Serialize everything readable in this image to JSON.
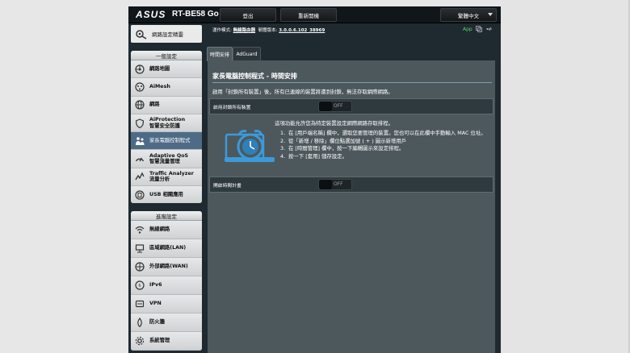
{
  "header": {
    "logo": "ASUS",
    "model": "RT-BE58 Go",
    "logout": "登出",
    "reboot": "重新開機",
    "language": "繁體中文"
  },
  "status": {
    "mode_label": "運作模式:",
    "mode_value": "無線路由器",
    "firmware_label": "韌體版本:",
    "firmware_value": "3.0.0.6.102_38969",
    "app_label": "App"
  },
  "sidebar": {
    "top_item": "網路設定精靈",
    "general_heading": "一般設定",
    "general_items": [
      {
        "label": "網路地圖",
        "icon": "network-map-icon"
      },
      {
        "label": "AiMesh",
        "icon": "aimesh-icon"
      },
      {
        "label": "網路",
        "icon": "globe-icon"
      },
      {
        "label": "AiProtection",
        "label2": "智慧安全防護",
        "icon": "shield-icon"
      },
      {
        "label": "家長電腦控制程式",
        "icon": "family-icon"
      },
      {
        "label": "Adaptive QoS",
        "label2": "智慧流量管理",
        "icon": "qos-icon"
      },
      {
        "label": "Traffic Analyzer",
        "label2": "流量分析",
        "icon": "analyzer-icon"
      },
      {
        "label": "USB 相關應用",
        "icon": "usb-icon"
      }
    ],
    "advanced_heading": "進階設定",
    "advanced_items": [
      {
        "label": "無線網路",
        "icon": "wireless-icon"
      },
      {
        "label": "區域網路(LAN)",
        "icon": "lan-icon"
      },
      {
        "label": "外部網路(WAN)",
        "icon": "wan-icon"
      },
      {
        "label": "IPv6",
        "icon": "ipv6-icon"
      },
      {
        "label": "VPN",
        "icon": "vpn-icon"
      },
      {
        "label": "防火牆",
        "icon": "firewall-icon"
      },
      {
        "label": "系統管理",
        "icon": "admin-icon"
      }
    ]
  },
  "tabs": {
    "time_schedule": "時間安排",
    "adguard": "AdGuard"
  },
  "main": {
    "title": "家長電腦控制程式 - 時間安排",
    "description": "啟用「封鎖所有裝置」後，所有已連線的裝置將遭到封鎖，無法存取網際網路。",
    "block_all_label": "啟用封鎖所有裝置",
    "block_all_state": "OFF",
    "intro": "這項功能允許您為特定裝置設定網際網路存取排程。",
    "steps": [
      {
        "num": "1.",
        "text": "在 [用戶端名稱] 欄中，選取您要管理的裝置。您也可以在此欄中手動輸入 MAC 位址。"
      },
      {
        "num": "2.",
        "text": "從「新增 / 移除」欄位點選加號 ( + ) 圖示新增用戶"
      },
      {
        "num": "3.",
        "text": "在 [時間管理] 欄中，按一下編輯圖示來設定排程。"
      },
      {
        "num": "4.",
        "text": "按一下 [套用] 儲存設定。"
      }
    ],
    "schedule_label": "開啟時間計畫",
    "schedule_state": "OFF"
  },
  "colors": {
    "active_item": "#4e6b86",
    "panel": "#4d585d",
    "accent_green": "#5fd35f",
    "clock_blue": "#3c9ad8"
  }
}
